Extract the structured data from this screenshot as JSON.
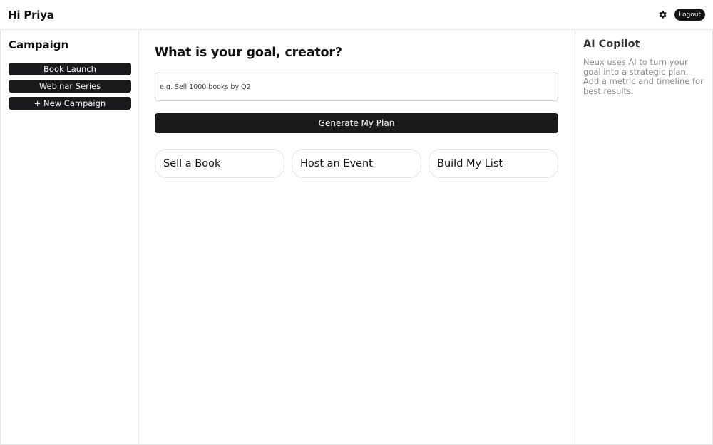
{
  "header": {
    "greeting": "Hi Priya",
    "settings_icon": "gear-icon",
    "logout_label": "Logout"
  },
  "sidebar": {
    "title": "Campaign",
    "campaigns": [
      {
        "label": "Book Launch"
      },
      {
        "label": "Webinar Series"
      },
      {
        "label": "+ New Campaign"
      }
    ]
  },
  "main": {
    "title": "What is your goal, creator?",
    "goal_input": {
      "value": "",
      "placeholder": "e.g. Sell 1000 books by Q2"
    },
    "generate_label": "Generate My Plan",
    "quick_goals": [
      {
        "label": "Sell a Book"
      },
      {
        "label": "Host an Event"
      },
      {
        "label": "Build My List"
      }
    ]
  },
  "copilot": {
    "title": "AI Copilot",
    "description": "Neux uses AI to turn your goal into a strategic plan. Add a metric and timeline for best results."
  },
  "colors": {
    "primary": "#1a1a1c",
    "border": "#e6e6e6",
    "muted_text": "#8a8a8a"
  }
}
